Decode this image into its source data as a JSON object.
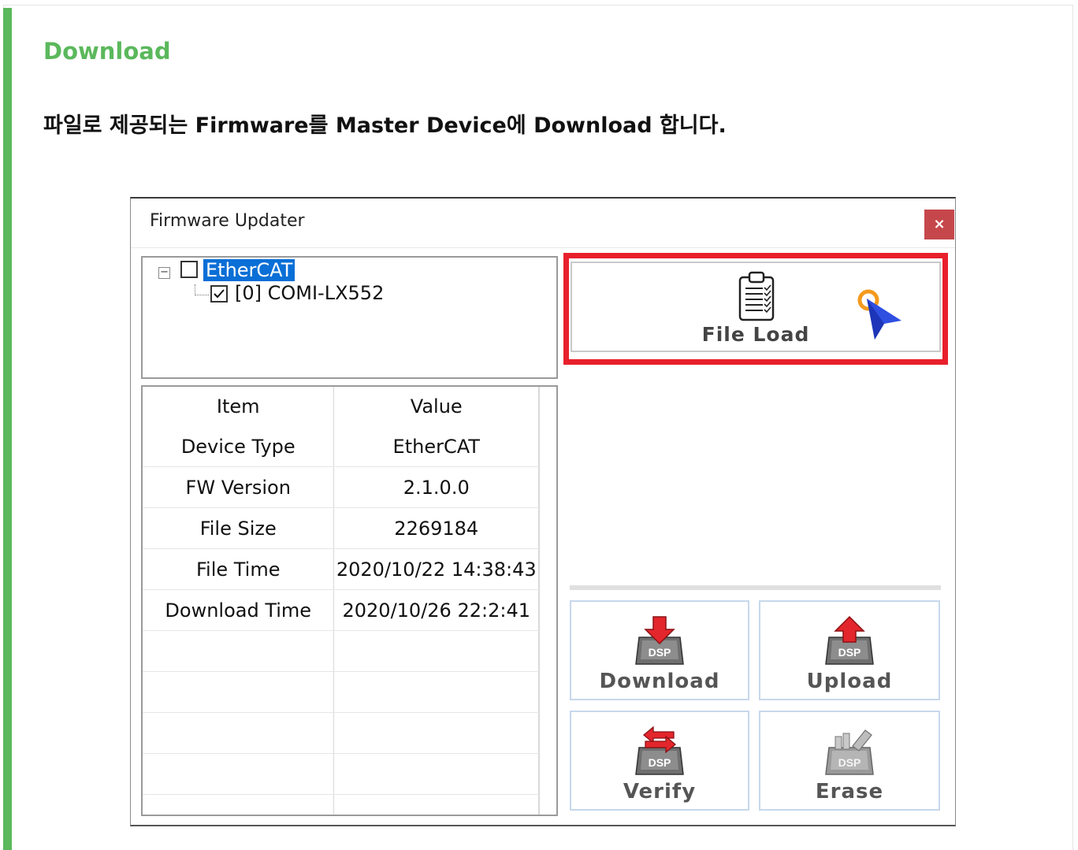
{
  "section": {
    "heading": "Download",
    "description": "파일로 제공되는 Firmware를 Master Device에 Download 합니다."
  },
  "window": {
    "title": "Firmware Updater",
    "close_label": "×"
  },
  "tree": {
    "root_label": "EtherCAT",
    "root_checked": false,
    "child_label": "[0] COMI-LX552",
    "child_checked": true
  },
  "info_table": {
    "headers": [
      "Item",
      "Value"
    ],
    "rows": [
      [
        "Device Type",
        "EtherCAT"
      ],
      [
        "FW Version",
        "2.1.0.0"
      ],
      [
        "File Size",
        "2269184"
      ],
      [
        "File Time",
        "2020/10/22 14:38:43"
      ],
      [
        "Download Time",
        "2020/10/26 22:2:41"
      ]
    ]
  },
  "file_load": {
    "label": "File Load",
    "icon": "clipboard-checklist-icon",
    "highlight_color": "#e8202c"
  },
  "actions": {
    "download": {
      "label": "Download",
      "icon": "dsp-download-icon",
      "chip": "DSP"
    },
    "upload": {
      "label": "Upload",
      "icon": "dsp-upload-icon",
      "chip": "DSP"
    },
    "verify": {
      "label": "Verify",
      "icon": "dsp-verify-icon",
      "chip": "DSP"
    },
    "erase": {
      "label": "Erase",
      "icon": "dsp-erase-icon",
      "chip": "DSP"
    }
  },
  "colors": {
    "accent_green": "#5bb85c",
    "selection_blue": "#0a6fd6",
    "close_red": "#c6474b",
    "arrow_red": "#e3262c"
  }
}
